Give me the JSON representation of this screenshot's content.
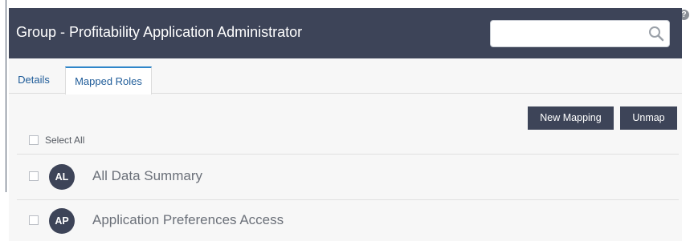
{
  "header": {
    "title": "Group - Profitability Application Administrator",
    "search": {
      "value": "",
      "placeholder": "",
      "icon": "search-icon"
    },
    "help_icon": "?"
  },
  "tabs": [
    {
      "label": "Details",
      "active": false
    },
    {
      "label": "Mapped Roles",
      "active": true
    }
  ],
  "toolbar": {
    "new_mapping_label": "New Mapping",
    "unmap_label": "Unmap"
  },
  "select_all": {
    "label": "Select All",
    "checked": false
  },
  "roles": [
    {
      "initials": "AL",
      "name": "All Data Summary",
      "checked": false
    },
    {
      "initials": "AP",
      "name": "Application Preferences Access",
      "checked": false
    }
  ],
  "colors": {
    "header_bg": "#3d4458",
    "button_bg": "#3d4458",
    "tab_active_border": "#2f86c9",
    "panel_bg": "#f7f7f7"
  }
}
